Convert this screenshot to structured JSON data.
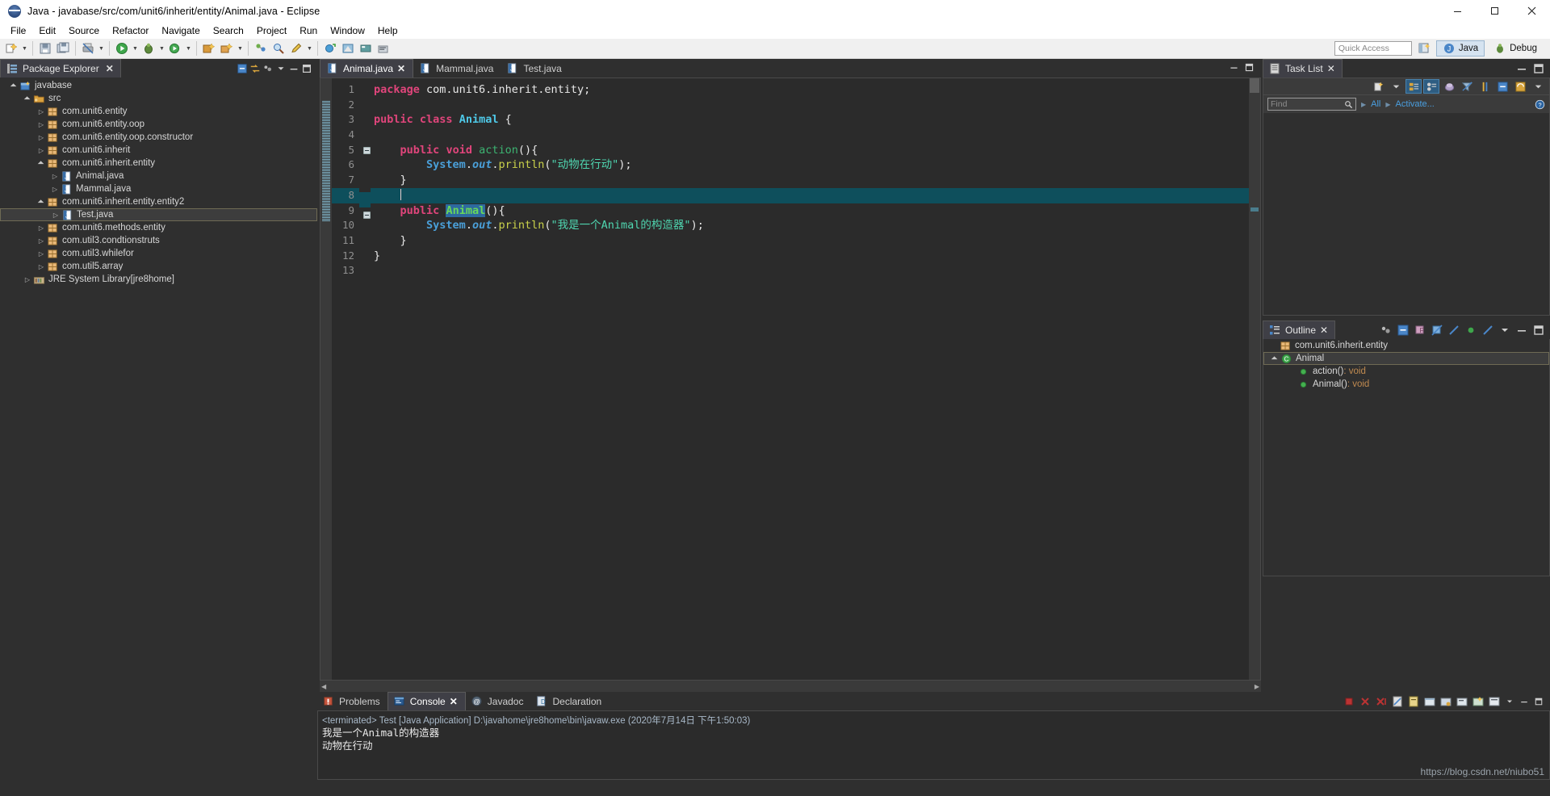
{
  "window": {
    "title": "Java - javabase/src/com/unit6/inherit/entity/Animal.java - Eclipse",
    "minimize": "–",
    "maximize": "❐",
    "close": "✕"
  },
  "menu": {
    "items": [
      "File",
      "Edit",
      "Source",
      "Refactor",
      "Navigate",
      "Search",
      "Project",
      "Run",
      "Window",
      "Help"
    ]
  },
  "toolbar": {
    "quick_access_placeholder": "Quick Access",
    "perspectives": [
      {
        "label": "Java",
        "active": true
      },
      {
        "label": "Debug",
        "active": false
      }
    ]
  },
  "package_explorer": {
    "title": "Package Explorer",
    "close_label": "✕",
    "tree": [
      {
        "label": "javabase",
        "indent": 0,
        "twisty": "open",
        "icon": "project-icon",
        "selected": false
      },
      {
        "label": "src",
        "indent": 1,
        "twisty": "open",
        "icon": "source-folder-icon",
        "selected": false
      },
      {
        "label": "com.unit6.entity",
        "indent": 2,
        "twisty": "closed",
        "icon": "package-icon",
        "selected": false
      },
      {
        "label": "com.unit6.entity.oop",
        "indent": 2,
        "twisty": "closed",
        "icon": "package-icon",
        "selected": false
      },
      {
        "label": "com.unit6.entity.oop.constructor",
        "indent": 2,
        "twisty": "closed",
        "icon": "package-icon",
        "selected": false
      },
      {
        "label": "com.unit6.inherit",
        "indent": 2,
        "twisty": "closed",
        "icon": "package-icon",
        "selected": false
      },
      {
        "label": "com.unit6.inherit.entity",
        "indent": 2,
        "twisty": "open",
        "icon": "package-icon",
        "selected": false
      },
      {
        "label": "Animal.java",
        "indent": 3,
        "twisty": "closed",
        "icon": "java-file-icon",
        "selected": false
      },
      {
        "label": "Mammal.java",
        "indent": 3,
        "twisty": "closed",
        "icon": "java-file-icon",
        "selected": false
      },
      {
        "label": "com.unit6.inherit.entity.entity2",
        "indent": 2,
        "twisty": "open",
        "icon": "package-icon",
        "selected": false
      },
      {
        "label": "Test.java",
        "indent": 3,
        "twisty": "closed",
        "icon": "java-file-icon",
        "selected": true
      },
      {
        "label": "com.unit6.methods.entity",
        "indent": 2,
        "twisty": "closed",
        "icon": "package-icon",
        "selected": false
      },
      {
        "label": "com.util3.condtionstruts",
        "indent": 2,
        "twisty": "closed",
        "icon": "package-icon",
        "selected": false
      },
      {
        "label": "com.util3.whilefor",
        "indent": 2,
        "twisty": "closed",
        "icon": "package-icon",
        "selected": false
      },
      {
        "label": "com.util5.array",
        "indent": 2,
        "twisty": "closed",
        "icon": "package-icon",
        "selected": false
      },
      {
        "label": "JRE System Library",
        "suffix": " [jre8home]",
        "indent": 1,
        "twisty": "closed",
        "icon": "library-icon",
        "selected": false
      }
    ]
  },
  "editor": {
    "tabs": [
      {
        "label": "Animal.java",
        "active": true,
        "closable": true
      },
      {
        "label": "Mammal.java",
        "active": false,
        "closable": false
      },
      {
        "label": "Test.java",
        "active": false,
        "closable": false
      }
    ],
    "line_numbers": [
      "1",
      "2",
      "3",
      "4",
      "5",
      "6",
      "7",
      "8",
      "9",
      "10",
      "11",
      "12",
      "13"
    ],
    "highlighted_line": 8,
    "fold_lines": [
      5,
      9
    ],
    "code_lines": [
      {
        "n": 1,
        "tokens": [
          {
            "t": "package",
            "c": "kw"
          },
          {
            "t": " com.unit6.inherit.entity;",
            "c": "pln"
          }
        ]
      },
      {
        "n": 2,
        "tokens": []
      },
      {
        "n": 3,
        "tokens": [
          {
            "t": "public",
            "c": "kw"
          },
          {
            "t": " ",
            "c": "pln"
          },
          {
            "t": "class",
            "c": "kw"
          },
          {
            "t": " ",
            "c": "pln"
          },
          {
            "t": "Animal",
            "c": "typ"
          },
          {
            "t": " {",
            "c": "pln"
          }
        ]
      },
      {
        "n": 4,
        "tokens": []
      },
      {
        "n": 5,
        "tokens": [
          {
            "t": "    ",
            "c": "pln"
          },
          {
            "t": "public",
            "c": "kw"
          },
          {
            "t": " ",
            "c": "pln"
          },
          {
            "t": "void",
            "c": "kw"
          },
          {
            "t": " ",
            "c": "pln"
          },
          {
            "t": "action",
            "c": "mth"
          },
          {
            "t": "(){",
            "c": "pln"
          }
        ]
      },
      {
        "n": 6,
        "tokens": [
          {
            "t": "        ",
            "c": "pln"
          },
          {
            "t": "System",
            "c": "fld"
          },
          {
            "t": ".",
            "c": "pln"
          },
          {
            "t": "out",
            "c": "fld-i"
          },
          {
            "t": ".",
            "c": "pln"
          },
          {
            "t": "println",
            "c": "cal"
          },
          {
            "t": "(",
            "c": "pln"
          },
          {
            "t": "\"动物在行动\"",
            "c": "str"
          },
          {
            "t": ");",
            "c": "pln"
          }
        ]
      },
      {
        "n": 7,
        "tokens": [
          {
            "t": "    }",
            "c": "pln"
          }
        ]
      },
      {
        "n": 8,
        "tokens": [
          {
            "t": "    ",
            "c": "pln"
          }
        ],
        "highlight": true,
        "caret": true
      },
      {
        "n": 9,
        "tokens": [
          {
            "t": "    ",
            "c": "pln"
          },
          {
            "t": "public",
            "c": "kw"
          },
          {
            "t": " ",
            "c": "pln"
          },
          {
            "t": "Animal",
            "c": "sel-tok"
          },
          {
            "t": "(){",
            "c": "pln"
          }
        ]
      },
      {
        "n": 10,
        "tokens": [
          {
            "t": "        ",
            "c": "pln"
          },
          {
            "t": "System",
            "c": "fld"
          },
          {
            "t": ".",
            "c": "pln"
          },
          {
            "t": "out",
            "c": "fld-i"
          },
          {
            "t": ".",
            "c": "pln"
          },
          {
            "t": "println",
            "c": "cal"
          },
          {
            "t": "(",
            "c": "pln"
          },
          {
            "t": "\"我是一个Animal的构造器\"",
            "c": "str"
          },
          {
            "t": ");",
            "c": "pln"
          }
        ]
      },
      {
        "n": 11,
        "tokens": [
          {
            "t": "    }",
            "c": "pln"
          }
        ]
      },
      {
        "n": 12,
        "tokens": [
          {
            "t": "}",
            "c": "pln"
          }
        ]
      },
      {
        "n": 13,
        "tokens": []
      }
    ]
  },
  "task_list": {
    "title": "Task List",
    "close_label": "✕",
    "find_placeholder": "Find",
    "filter_all": "All",
    "activate": "Activate..."
  },
  "outline": {
    "title": "Outline",
    "close_label": "✕",
    "rows": [
      {
        "label": "com.unit6.inherit.entity",
        "icon": "package-icon",
        "indent": 0,
        "twisty": "none",
        "selected": false,
        "type": ""
      },
      {
        "label": "Animal",
        "icon": "class-icon",
        "indent": 0,
        "twisty": "open",
        "selected": true,
        "type": ""
      },
      {
        "label": "action()",
        "icon": "method-public-icon",
        "indent": 1,
        "twisty": "none",
        "selected": false,
        "type": " : void"
      },
      {
        "label": "Animal()",
        "icon": "method-public-icon",
        "indent": 1,
        "twisty": "none",
        "selected": false,
        "type": " : void"
      }
    ]
  },
  "console": {
    "tabs": [
      {
        "label": "Problems",
        "icon": "problems-icon",
        "active": false,
        "closable": false
      },
      {
        "label": "Console",
        "icon": "console-icon",
        "active": true,
        "closable": true
      },
      {
        "label": "Javadoc",
        "icon": "javadoc-icon",
        "active": false,
        "closable": false
      },
      {
        "label": "Declaration",
        "icon": "declaration-icon",
        "active": false,
        "closable": false
      }
    ],
    "close_label": "✕",
    "status_line": "<terminated> Test [Java Application] D:\\javahome\\jre8home\\bin\\javaw.exe (2020年7月14日 下午1:50:03)",
    "output_lines": [
      "我是一个Animal的构造器",
      "动物在行动"
    ]
  },
  "watermark": {
    "text": "https://blog.csdn.net/niubo51"
  },
  "colors": {
    "accent_selection": "#0e4f5c",
    "keyword": "#e0457b",
    "type": "#4ec9e8",
    "string": "#4fd6b0",
    "method": "#3cb371",
    "field": "#4a9fd8",
    "call": "#c9d14a",
    "editor_bg": "#2b2b2b",
    "chrome_bg": "#2f2f2f"
  }
}
